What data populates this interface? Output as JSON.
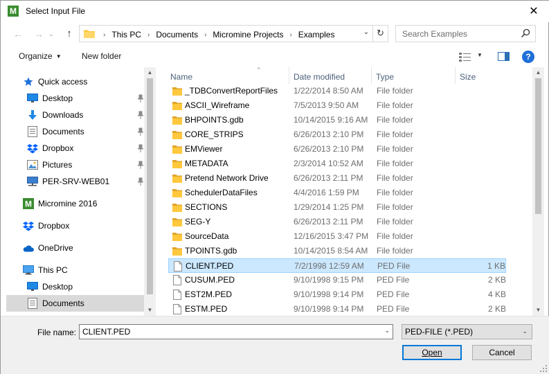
{
  "window": {
    "title": "Select Input File",
    "app_icon_letter": "M",
    "close_glyph": "✕"
  },
  "address_bar": {
    "crumbs": [
      "This PC",
      "Documents",
      "Micromine Projects",
      "Examples"
    ],
    "search_placeholder": "Search Examples"
  },
  "toolbar": {
    "organize_label": "Organize",
    "new_folder_label": "New folder",
    "help_label": "?"
  },
  "nav_pane": {
    "items": [
      {
        "label": "Quick access",
        "icon": "star-icon",
        "pinned": false
      },
      {
        "label": "Desktop",
        "icon": "desktop-icon",
        "pinned": true
      },
      {
        "label": "Downloads",
        "icon": "download-icon",
        "pinned": true
      },
      {
        "label": "Documents",
        "icon": "documents-icon",
        "pinned": true
      },
      {
        "label": "Dropbox",
        "icon": "dropbox-icon",
        "pinned": true
      },
      {
        "label": "Pictures",
        "icon": "pictures-icon",
        "pinned": true
      },
      {
        "label": "PER-SRV-WEB01",
        "icon": "network-drive-icon",
        "pinned": true
      },
      {
        "label": "Micromine 2016",
        "icon": "micromine-icon",
        "pinned": false
      },
      {
        "label": "Dropbox",
        "icon": "dropbox-icon",
        "pinned": false
      },
      {
        "label": "OneDrive",
        "icon": "onedrive-icon",
        "pinned": false
      },
      {
        "label": "This PC",
        "icon": "computer-icon",
        "pinned": false
      },
      {
        "label": "Desktop",
        "icon": "desktop-icon",
        "pinned": false
      },
      {
        "label": "Documents",
        "icon": "documents-icon",
        "pinned": false,
        "selected": true
      }
    ]
  },
  "file_list": {
    "columns": {
      "name": "Name",
      "date": "Date modified",
      "type": "Type",
      "size": "Size"
    },
    "rows": [
      {
        "name": "_TDBConvertReportFiles",
        "date": "1/22/2014 8:50 AM",
        "type": "File folder",
        "size": "",
        "kind": "folder"
      },
      {
        "name": "ASCII_Wireframe",
        "date": "7/5/2013 9:50 AM",
        "type": "File folder",
        "size": "",
        "kind": "folder"
      },
      {
        "name": "BHPOINTS.gdb",
        "date": "10/14/2015 9:16 AM",
        "type": "File folder",
        "size": "",
        "kind": "folder"
      },
      {
        "name": "CORE_STRIPS",
        "date": "6/26/2013 2:10 PM",
        "type": "File folder",
        "size": "",
        "kind": "folder"
      },
      {
        "name": "EMViewer",
        "date": "6/26/2013 2:10 PM",
        "type": "File folder",
        "size": "",
        "kind": "folder"
      },
      {
        "name": "METADATA",
        "date": "2/3/2014 10:52 AM",
        "type": "File folder",
        "size": "",
        "kind": "folder"
      },
      {
        "name": "Pretend Network Drive",
        "date": "6/26/2013 2:11 PM",
        "type": "File folder",
        "size": "",
        "kind": "folder"
      },
      {
        "name": "SchedulerDataFiles",
        "date": "4/4/2016 1:59 PM",
        "type": "File folder",
        "size": "",
        "kind": "folder"
      },
      {
        "name": "SECTIONS",
        "date": "1/29/2014 1:25 PM",
        "type": "File folder",
        "size": "",
        "kind": "folder"
      },
      {
        "name": "SEG-Y",
        "date": "6/26/2013 2:11 PM",
        "type": "File folder",
        "size": "",
        "kind": "folder"
      },
      {
        "name": "SourceData",
        "date": "12/16/2015 3:47 PM",
        "type": "File folder",
        "size": "",
        "kind": "folder"
      },
      {
        "name": "TPOINTS.gdb",
        "date": "10/14/2015 8:54 AM",
        "type": "File folder",
        "size": "",
        "kind": "folder"
      },
      {
        "name": "CLIENT.PED",
        "date": "7/2/1998 12:59 AM",
        "type": "PED File",
        "size": "1 KB",
        "kind": "file",
        "selected": true
      },
      {
        "name": "CUSUM.PED",
        "date": "9/10/1998 9:15 PM",
        "type": "PED File",
        "size": "2 KB",
        "kind": "file"
      },
      {
        "name": "EST2M.PED",
        "date": "9/10/1998 9:14 PM",
        "type": "PED File",
        "size": "4 KB",
        "kind": "file"
      },
      {
        "name": "ESTM.PED",
        "date": "9/10/1998 9:14 PM",
        "type": "PED File",
        "size": "2 KB",
        "kind": "file"
      }
    ]
  },
  "bottom": {
    "file_name_label": "File name:",
    "file_name_value": "CLIENT.PED",
    "filter_value": "PED-FILE (*.PED)",
    "open_label": "Open",
    "cancel_label": "Cancel"
  },
  "colors": {
    "selection_bg": "#cce8ff",
    "selection_border": "#99d1ff",
    "folder": "#ffc83d",
    "accent": "#0078d7",
    "app_icon": "#3a8c2f"
  }
}
